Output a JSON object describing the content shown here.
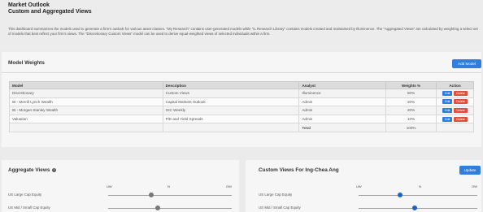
{
  "header": {
    "title_line1": "Market Outlook",
    "title_line2": "Custom and Aggregated Views",
    "description": "This dashboard summarizes the models used to generate a firm's outlook for various asset classes. \"My Research\" contains user-generated models while \"IL Research Library\" contains models created and maintained by Illuminence. The \"Aggregated Views\" are calculated by weighting a select set of models that best reflect your firm's views. The \"Discretionary Custom Views\" model can be used to derive equal-weighted views of selected individuals within a firm."
  },
  "model_weights": {
    "title": "Model Weights",
    "add_button": "Add Model",
    "columns": [
      "Model",
      "Description",
      "Analyst",
      "Weights %",
      "Action"
    ],
    "rows": [
      {
        "model": "Discretionary",
        "description": "Custom Views",
        "analyst": "Illuminence",
        "weight": "50%"
      },
      {
        "model": "IB - Merrill Lynch Wealth",
        "description": "Capital Markets Outlook",
        "analyst": "Admin",
        "weight": "20%"
      },
      {
        "model": "IB - Morgan Stanley Wealth",
        "description": "GIC Weekly",
        "analyst": "Admin",
        "weight": "20%"
      },
      {
        "model": "Valuation",
        "description": "P/E and Yield Spreads",
        "analyst": "Admin",
        "weight": "10%"
      }
    ],
    "total_label": "Total",
    "total_value": "100%",
    "edit_label": "Edit",
    "delete_label": "Delete"
  },
  "aggregate_views": {
    "title": "Aggregate Views",
    "info_icon": "i",
    "scale": {
      "left": "UW",
      "mid": "N",
      "right": "OW"
    },
    "items": [
      {
        "label": "US Large Cap Equity",
        "position": 0.35
      },
      {
        "label": "US Mid / Small Cap Equity",
        "position": 0.4
      }
    ]
  },
  "custom_views": {
    "title": "Custom Views For Ing-Chea Ang",
    "update_button": "Update",
    "scale": {
      "left": "UW",
      "mid": "N",
      "right": "OW"
    },
    "items": [
      {
        "label": "US Large Cap Equity",
        "position": 0.35
      },
      {
        "label": "US Mid / Small Cap Equity",
        "position": 0.47
      }
    ]
  },
  "colors": {
    "accent": "#2f7ddd",
    "danger": "#e0503e",
    "slider_aggregate": "#777777",
    "slider_custom": "#1f62c9"
  }
}
